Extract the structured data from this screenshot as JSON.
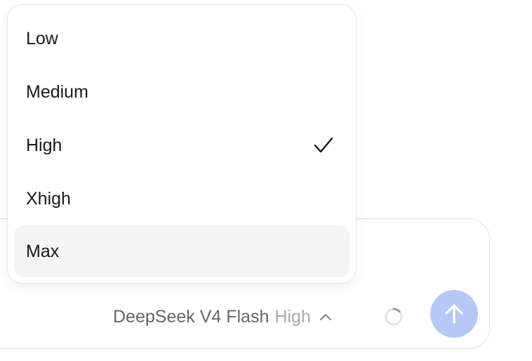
{
  "effort_menu": {
    "items": [
      {
        "label": "Low",
        "selected": false
      },
      {
        "label": "Medium",
        "selected": false
      },
      {
        "label": "High",
        "selected": true
      },
      {
        "label": "Xhigh",
        "selected": false
      },
      {
        "label": "Max",
        "selected": false
      }
    ],
    "hovered_item": "Max"
  },
  "composer": {
    "model_name": "DeepSeek V4 Flash",
    "effort_label": "High",
    "chevron_icon": "chevron-up-icon",
    "status_icon": "loading-spinner-icon",
    "send_icon": "arrow-up-icon",
    "send_button_color": "#b8c8f6"
  }
}
